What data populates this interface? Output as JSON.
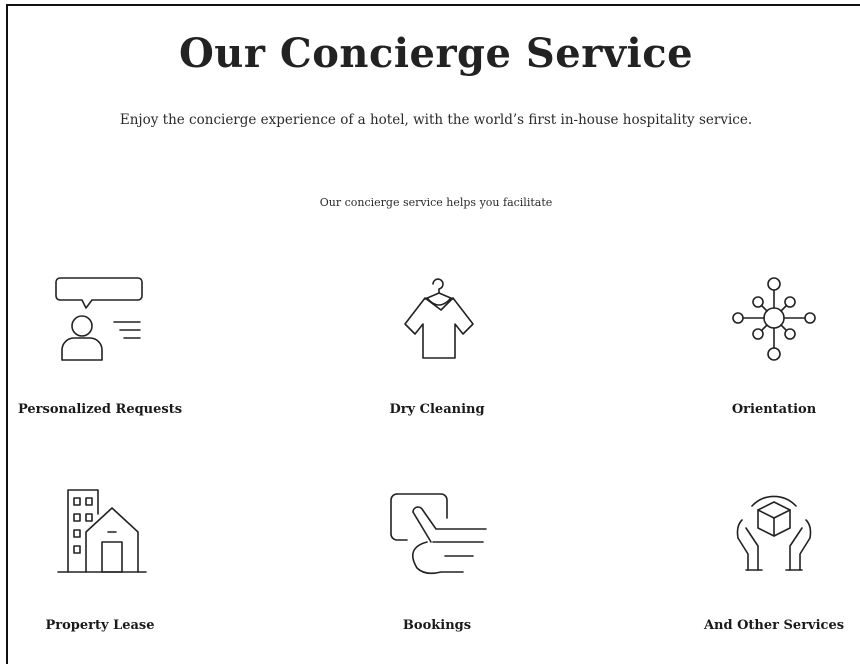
{
  "header": {
    "title": "Our Concierge Service",
    "subtitle": "Enjoy the concierge experience of a hotel, with the world’s first in-house hospitality service.",
    "lead": "Our concierge service helps you facilitate"
  },
  "services": [
    {
      "label": "Personalized Requests",
      "icon": "chat-person-icon"
    },
    {
      "label": "Dry Cleaning",
      "icon": "shirt-hanger-icon"
    },
    {
      "label": "Orientation",
      "icon": "network-nodes-icon"
    },
    {
      "label": "Property Lease",
      "icon": "buildings-icon"
    },
    {
      "label": "Bookings",
      "icon": "hand-tap-icon"
    },
    {
      "label": "And Other Services",
      "icon": "hands-box-icon"
    }
  ],
  "colors": {
    "text": "#1a1a1a",
    "background": "#ffffff",
    "icon_stroke": "#222222"
  }
}
